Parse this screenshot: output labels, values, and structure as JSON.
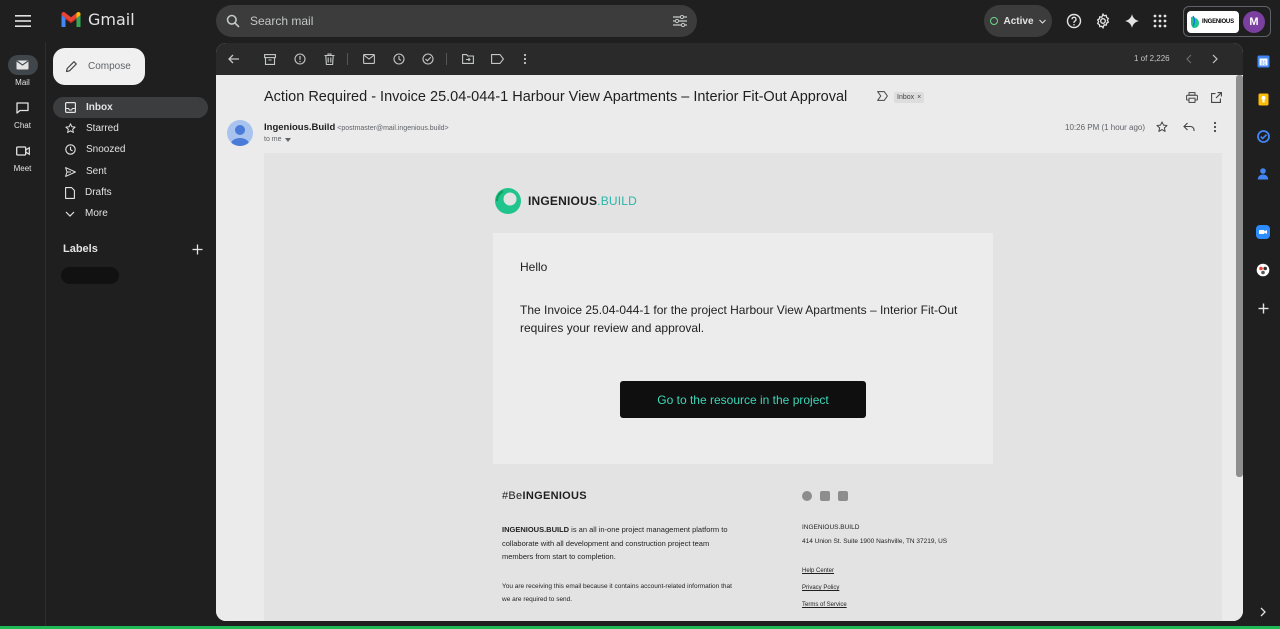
{
  "header": {
    "app_name": "Gmail",
    "search_placeholder": "Search mail",
    "status": "Active",
    "account_initial": "M",
    "account_brand": "INGENIOUS"
  },
  "rail": [
    {
      "label": "Mail"
    },
    {
      "label": "Chat"
    },
    {
      "label": "Meet"
    }
  ],
  "sidebar": {
    "compose": "Compose",
    "items": [
      {
        "label": "Inbox"
      },
      {
        "label": "Starred"
      },
      {
        "label": "Snoozed"
      },
      {
        "label": "Sent"
      },
      {
        "label": "Drafts"
      },
      {
        "label": "More"
      }
    ],
    "labels_title": "Labels"
  },
  "toolbar": {
    "pager": "1 of 2,226"
  },
  "message": {
    "subject": "Action Required - Invoice 25.04-044-1 Harbour View Apartments – Interior Fit-Out Approval",
    "badge": "Inbox",
    "sender_name": "Ingenious.Build",
    "sender_email": "<postmaster@mail.ingenious.build>",
    "recipient": "to me",
    "timestamp": "10:26 PM (1 hour ago)"
  },
  "email": {
    "brand_main": "INGENIOUS",
    "brand_suffix": ".BUILD",
    "greeting": "Hello",
    "paragraph": "The Invoice 25.04-044-1 for the project Harbour View Apartments – Interior Fit-Out requires your review and approval.",
    "cta": "Go to the resource in the project",
    "tagline_prefix": "#Be",
    "tagline_bold": "INGENIOUS",
    "about_bold": "INGENIOUS.BUILD",
    "about_rest": " is an all in-one project management platform to collaborate with all development and construction project team members from start to completion.",
    "note": "You are receiving this email because it contains account-related information that we are required to send.",
    "company": "INGENIOUS.BUILD",
    "address": "414 Union St. Suite 1900 Nashville, TN 37219, US",
    "links": [
      "Help Center",
      "Privacy Policy",
      "Terms of Service"
    ]
  },
  "colors": {
    "accent_teal": "#3dd7b8",
    "gmail_red": "#ea4335",
    "avatar_purple": "#7b3fa0"
  }
}
